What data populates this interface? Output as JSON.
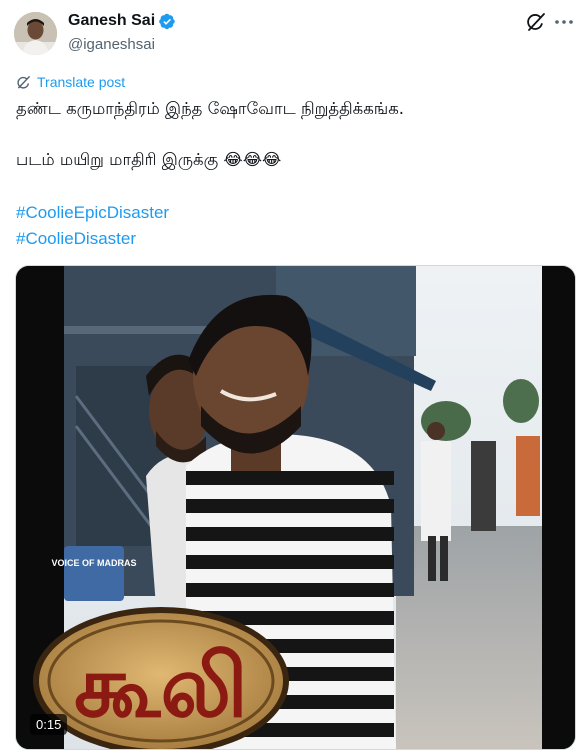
{
  "post": {
    "author_name": "Ganesh Sai",
    "author_handle": "@iganeshsai",
    "translate_label": "Translate post",
    "text_line1": "தண்ட கருமாந்திரம் இந்த ஷோவோட நிறுத்திக்கங்க.",
    "text_line2": "படம் மயிறு மாதிரி இருக்கு 😂😂😂",
    "hashtags": [
      "#CoolieEpicDisaster",
      "#CoolieDisaster"
    ]
  },
  "media": {
    "duration": "0:15",
    "sign_text": "VOICE OF MADRAS",
    "title_logo_text": "கூலி"
  },
  "colors": {
    "accent": "#1d9bf0",
    "secondary_text": "#536471",
    "primary_text": "#0f1419"
  }
}
